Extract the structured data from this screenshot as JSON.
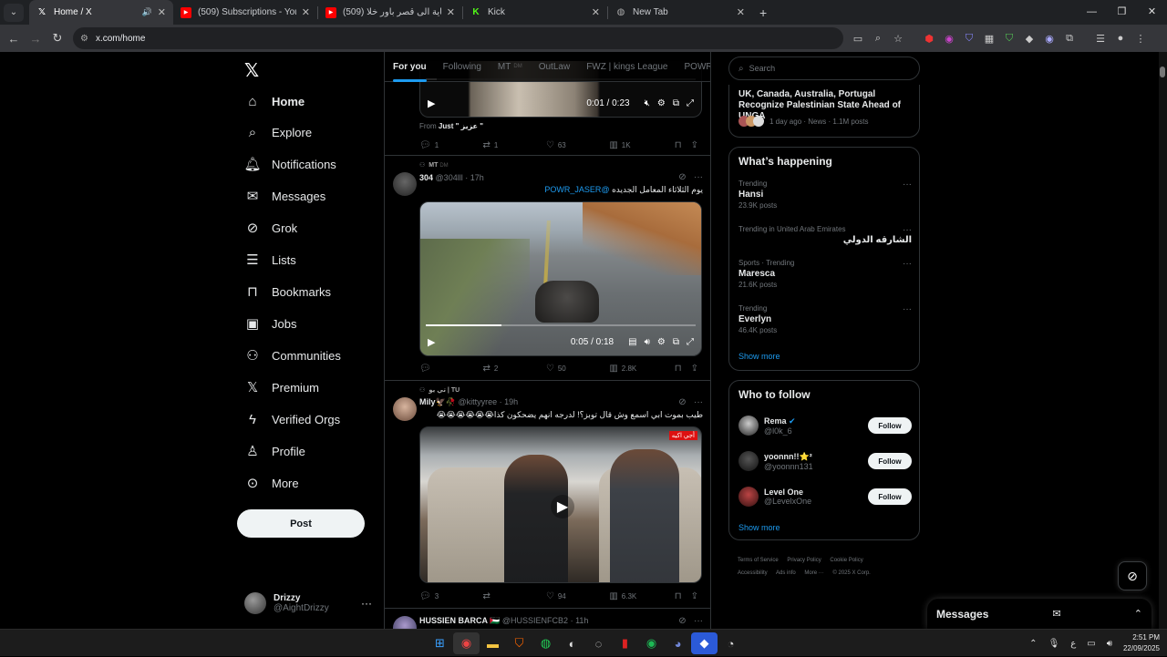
{
  "browser": {
    "tabs": [
      {
        "title": "Home / X",
        "favicon": "x-logo",
        "active": true,
        "audio": true
      },
      {
        "title": "(509) Subscriptions - YouTube",
        "favicon": "youtube-logo",
        "active": false
      },
      {
        "title": "(509) من الغاية الى قصر باور خلا",
        "favicon": "youtube-logo",
        "active": false
      },
      {
        "title": "Kick",
        "favicon": "kick-logo",
        "active": false
      },
      {
        "title": "New Tab",
        "favicon": "globe-icon",
        "active": false
      }
    ],
    "new_tab": "+",
    "url": "x.com/home"
  },
  "nav": {
    "items": [
      {
        "label": "Home",
        "icon": "home-icon",
        "active": true
      },
      {
        "label": "Explore",
        "icon": "search-icon"
      },
      {
        "label": "Notifications",
        "icon": "bell-icon"
      },
      {
        "label": "Messages",
        "icon": "envelope-icon"
      },
      {
        "label": "Grok",
        "icon": "grok-icon"
      },
      {
        "label": "Lists",
        "icon": "list-icon"
      },
      {
        "label": "Bookmarks",
        "icon": "bookmark-icon"
      },
      {
        "label": "Jobs",
        "icon": "briefcase-icon"
      },
      {
        "label": "Communities",
        "icon": "people-icon"
      },
      {
        "label": "Premium",
        "icon": "x-logo-icon"
      },
      {
        "label": "Verified Orgs",
        "icon": "lightning-icon"
      },
      {
        "label": "Profile",
        "icon": "person-icon"
      },
      {
        "label": "More",
        "icon": "more-circle-icon"
      }
    ],
    "post_label": "Post",
    "account": {
      "name": "Drizzy",
      "handle": "@AightDrizzy"
    }
  },
  "feed": {
    "tabs": [
      {
        "label": "For you",
        "active": true
      },
      {
        "label": "Following"
      },
      {
        "label": "MT",
        "suffix": "DM"
      },
      {
        "label": "OutLaw"
      },
      {
        "label": "FWZ | kings League"
      },
      {
        "label": "POWR | ور"
      }
    ],
    "tweet1": {
      "video_time": "0:01 / 0:23",
      "progress": 0.04,
      "from_text": "From",
      "from_name": "Just \" عزيز \"",
      "replies": "1",
      "reposts": "1",
      "likes": "63",
      "views": "1K"
    },
    "tweet2": {
      "context": "MT",
      "context_suffix": "DM",
      "name": "304",
      "handle": "@304lll",
      "time": "17h",
      "text": "يوم الثلاثاء المعامل الجديده",
      "mention": "@POWR_JASER",
      "video_time": "0:05 / 0:18",
      "progress": 0.28,
      "replies": "",
      "reposts": "2",
      "likes": "50",
      "views": "2.8K"
    },
    "tweet3": {
      "context": "تي يو | TU",
      "name": "Mily",
      "name_emoji": "🦅🥀",
      "handle": "@kittyyree",
      "time": "19h",
      "text": "طيب بموت ابي اسمع وش قال توبز؟! لدرجه انهم يضحكون كذا😭😭😭😭😭😭",
      "video_badge": "أجي اكيه",
      "replies": "3",
      "reposts": "",
      "likes": "94",
      "views": "6.3K"
    },
    "tweet4": {
      "name": "HUSSIEN BARCA 🇵🇸",
      "handle": "@HUSSIENFCB2",
      "time": "11h"
    }
  },
  "right": {
    "search_placeholder": "Search",
    "news": {
      "title": "UK, Canada, Australia, Portugal Recognize Palestinian State Ahead of UNGA",
      "meta": "1 day ago · News · 1.1M posts"
    },
    "whats_happening": {
      "title": "What’s happening",
      "trends": [
        {
          "meta": "Trending",
          "name": "Hansi",
          "count": "23.9K posts"
        },
        {
          "meta": "Trending in United Arab Emirates",
          "name": "الشارقه الدولي",
          "count": "",
          "rtl": true
        },
        {
          "meta": "Sports · Trending",
          "name": "Maresca",
          "count": "21.6K posts"
        },
        {
          "meta": "Trending",
          "name": "Everlyn",
          "count": "46.4K posts"
        }
      ],
      "show_more": "Show more"
    },
    "who_to_follow": {
      "title": "Who to follow",
      "people": [
        {
          "name": "Rema",
          "handle": "@l0k_6",
          "verified": true,
          "badge": ""
        },
        {
          "name": "yoonnn!!⭐²",
          "handle": "@yoonnn131",
          "verified": false
        },
        {
          "name": "Level One",
          "handle": "@LevelxOne",
          "verified": false
        }
      ],
      "follow_label": "Follow",
      "show_more": "Show more"
    },
    "footer": [
      "Terms of Service",
      "Privacy Policy",
      "Cookie Policy",
      "Accessibility",
      "Ads info",
      "More ···",
      "© 2025 X Corp."
    ]
  },
  "messages_drawer": {
    "title": "Messages"
  },
  "taskbar": {
    "time": "2:51 PM",
    "date": "22/09/2025",
    "lang": "ع"
  }
}
